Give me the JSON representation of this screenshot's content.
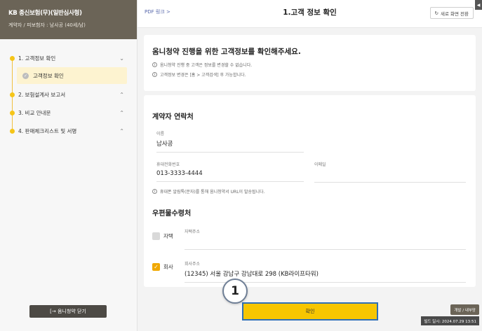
{
  "sidebar": {
    "title": "KB 종신보험(무)(일반심사형)",
    "subtitle": "계약자 / 피보험자 : 남사공 (40세/남)",
    "items": [
      {
        "label": "1. 고객정보 확인",
        "chevron": "⌄",
        "sub": [
          {
            "label": "고객정보 확인"
          }
        ]
      },
      {
        "label": "2. 보험설계사 보고서",
        "chevron": "⌃"
      },
      {
        "label": "3. 비교 안내문",
        "chevron": "⌃"
      },
      {
        "label": "4. 판매체크리스트 및 서명",
        "chevron": "⌃"
      }
    ],
    "close_label": "[→ 옴니청약 닫기"
  },
  "header": {
    "pdf_link": "PDF 링크 >",
    "title": "1.고객 정보 확인",
    "refresh_label": "새로 화면 전환",
    "collapse_glyph": "◀"
  },
  "intro": {
    "title": "옴니청약 진행을 위한 고객정보를 확인해주세요.",
    "notes": [
      "옴니청약 진행 중 고객은 정보를 변경할 수 없습니다.",
      "고객정보 변경은 [홈 > 고객검색] 후 가능합니다."
    ]
  },
  "contact": {
    "title": "계약자 연락처",
    "name_label": "이름",
    "name_value": "남사공",
    "phone_label": "휴대전화번호",
    "phone_value": "013-3333-4444",
    "email_label": "이메일",
    "email_value": "",
    "notice": "휴대폰 알림톡(문자)를 통해 옴니청약서 URL이 발송됩니다."
  },
  "mail": {
    "title": "우편물수령처",
    "home_label": "자택",
    "home_addr_label": "자택주소",
    "home_addr_value": "",
    "home_checked": false,
    "office_label": "회사",
    "office_addr_label": "회사주소",
    "office_addr_value": "(12345) 서울 강남구 강남대로 298 (KB라이프타워)",
    "office_checked": true
  },
  "footer": {
    "confirm_label": "확인",
    "step_number": "1",
    "dev_label": "개발 / 내부망",
    "build_info": "빌드 일시: 2024.07.29 13:51"
  },
  "colors": {
    "header_bg": "#6b6457",
    "accent_yellow": "#f7c600",
    "highlight_border": "#2f6fb5"
  }
}
